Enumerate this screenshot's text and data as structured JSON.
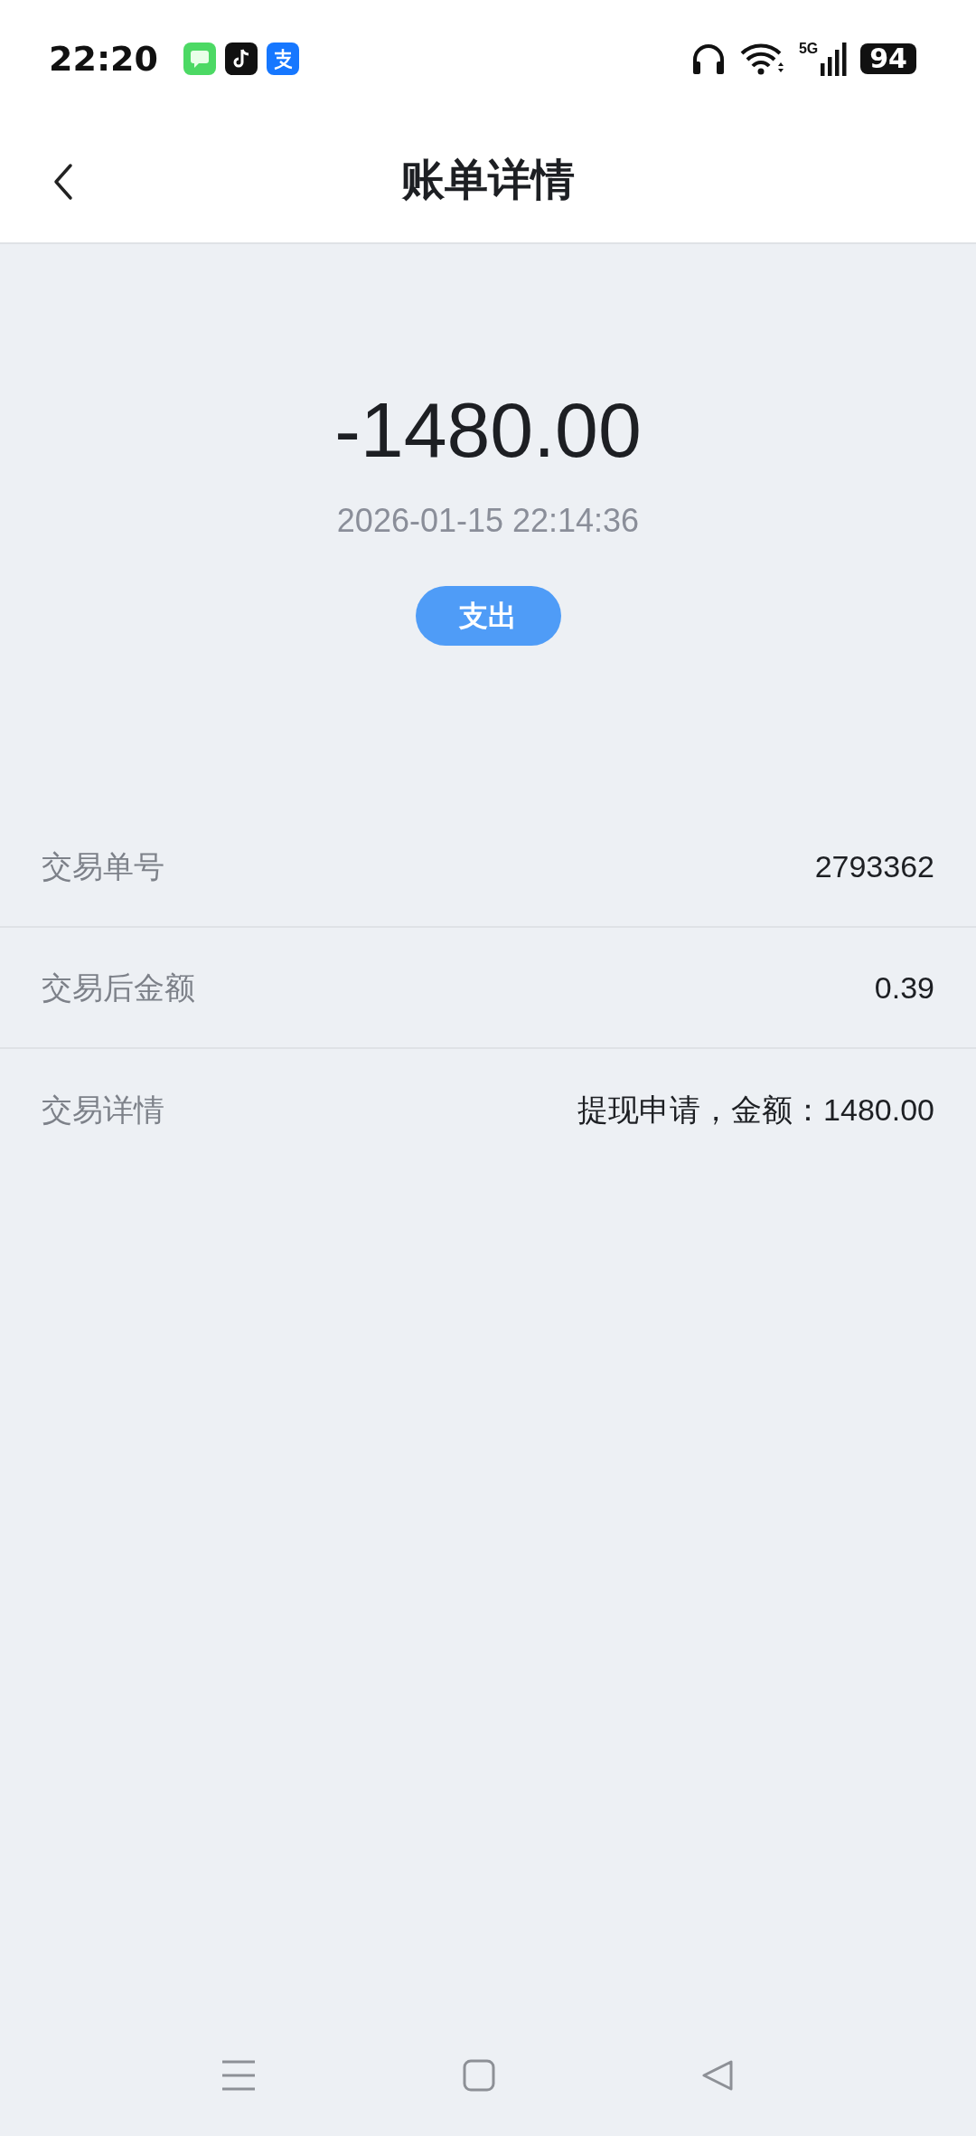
{
  "status_bar": {
    "time": "22:20",
    "network": "5G",
    "battery": "94"
  },
  "header": {
    "title": "账单详情"
  },
  "summary": {
    "amount": "-1480.00",
    "datetime": "2026-01-15 22:14:36",
    "type_badge": "支出"
  },
  "details": [
    {
      "label": "交易单号",
      "value": "2793362"
    },
    {
      "label": "交易后金额",
      "value": "0.39"
    },
    {
      "label": "交易详情",
      "value": "提现申请，金额：1480.00"
    }
  ]
}
